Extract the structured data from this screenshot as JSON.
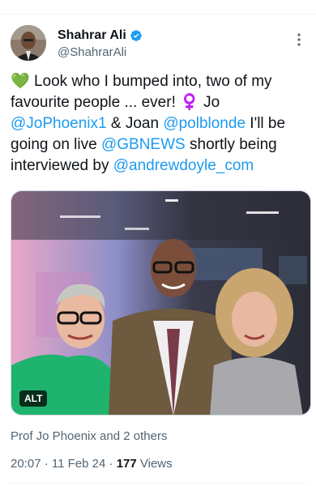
{
  "author": {
    "display_name": "Shahrar Ali",
    "handle": "@ShahrarAli"
  },
  "icons": {
    "verified": "verified-badge-icon",
    "more": "more-options-icon",
    "green_heart": "💚",
    "female_sign": "♀️"
  },
  "tweet": {
    "text_1": " Look who I bumped into, two of my favourite people ... ever! ",
    "text_2": " Jo ",
    "mention_1": "@JoPhoenix1",
    "text_3": " & Joan ",
    "mention_2": "@polblonde",
    "text_4": " I'll be going on live ",
    "mention_3": "@GBNEWS",
    "text_5": " shortly being interviewed by ",
    "mention_4": "@andrewdoyle_com"
  },
  "media": {
    "alt_label": "ALT"
  },
  "liked_by": "Prof Jo Phoenix and 2 others",
  "meta": {
    "time": "20:07",
    "sep1": " · ",
    "date": "11 Feb 24",
    "sep2": " · ",
    "views_count": "177",
    "views_label": " Views"
  },
  "colors": {
    "link": "#1d9bf0",
    "secondary_text": "#536471",
    "primary_text": "#0f1419"
  }
}
